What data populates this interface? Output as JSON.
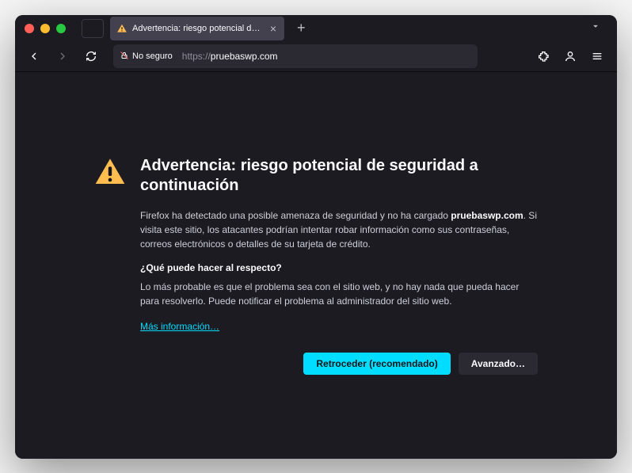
{
  "tab": {
    "title": "Advertencia: riesgo potencial de seguridad"
  },
  "urlbar": {
    "security_label": "No seguro",
    "protocol": "https://",
    "domain": "pruebaswp.com"
  },
  "warning": {
    "title": "Advertencia: riesgo potencial de seguridad a continuación",
    "paragraph_pre": "Firefox ha detectado una posible amenaza de seguridad y no ha cargado ",
    "paragraph_bold": "pruebaswp.com",
    "paragraph_post": ". Si visita este sitio, los atacantes podrían intentar robar información como sus contraseñas, correos electrónicos o detalles de su tarjeta de crédito.",
    "subheading": "¿Qué puede hacer al respecto?",
    "paragraph2": "Lo más probable es que el problema sea con el sitio web, y no hay nada que pueda hacer para resolverlo. Puede notificar el problema al administrador del sitio web.",
    "link": "Más información…",
    "button_primary": "Retroceder (recomendado)",
    "button_secondary": "Avanzado…"
  }
}
